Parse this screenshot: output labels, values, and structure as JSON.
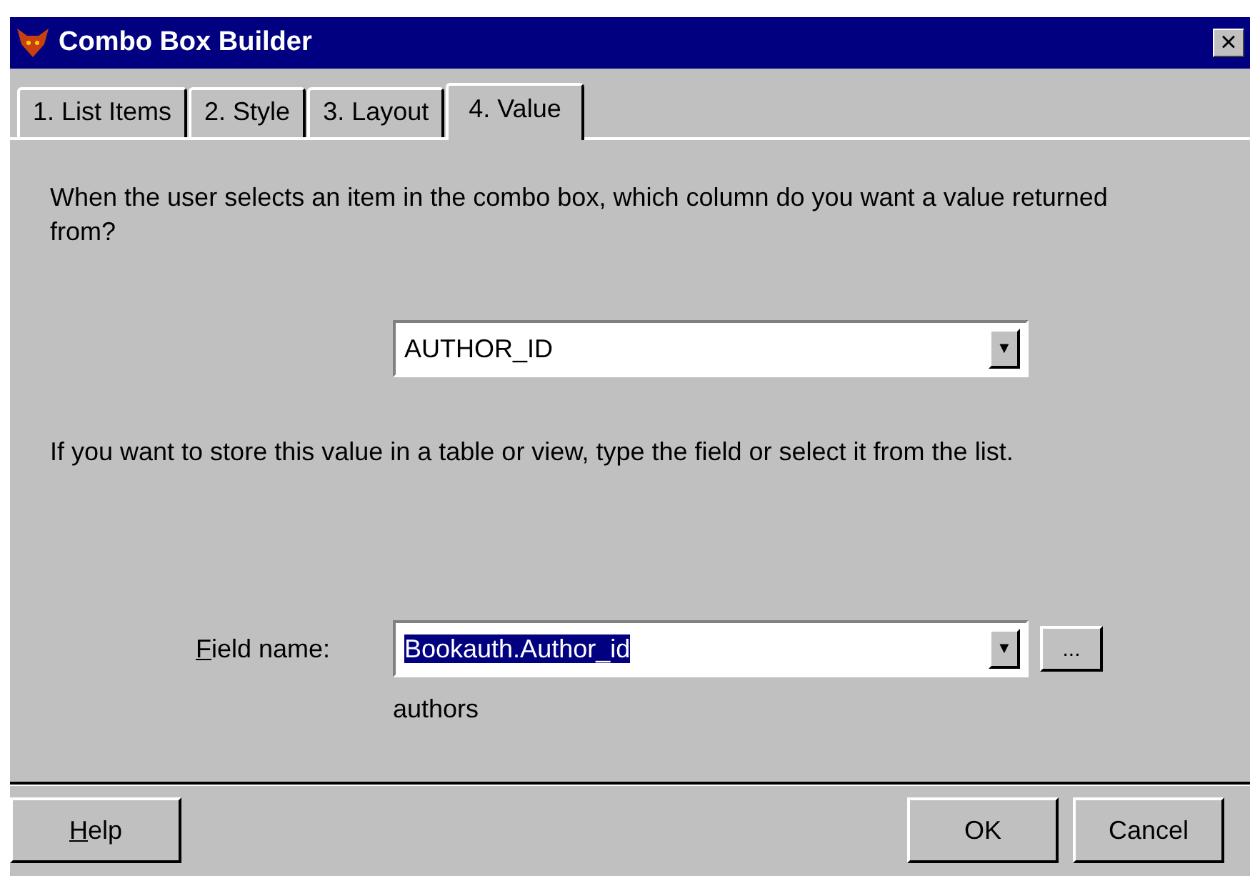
{
  "window": {
    "title": "Combo Box Builder",
    "close": "×"
  },
  "tabs": [
    {
      "label": "1. List Items",
      "selected": false
    },
    {
      "label": "2. Style",
      "selected": false
    },
    {
      "label": "3. Layout",
      "selected": false
    },
    {
      "label": "4. Value",
      "selected": true
    }
  ],
  "question": "When the user selects an item in the combo box, which column do you want a value returned from?",
  "column_combo": {
    "value": "AUTHOR_ID",
    "arrow": "▼"
  },
  "store_hint": "If you want to store this value in a table or view, type the field or select it from the list.",
  "field": {
    "label": "Field name:",
    "label_underline_first": true,
    "value": "Bookauth.Author_id",
    "value_selected": true,
    "arrow": "▼",
    "browse": "...",
    "table": "authors"
  },
  "buttons": [
    {
      "label": "Help",
      "underline_first": true,
      "kind": "left"
    },
    {
      "label": "OK",
      "underline_first": false,
      "kind": "right"
    },
    {
      "label": "Cancel",
      "underline_first": false,
      "kind": "right"
    }
  ]
}
